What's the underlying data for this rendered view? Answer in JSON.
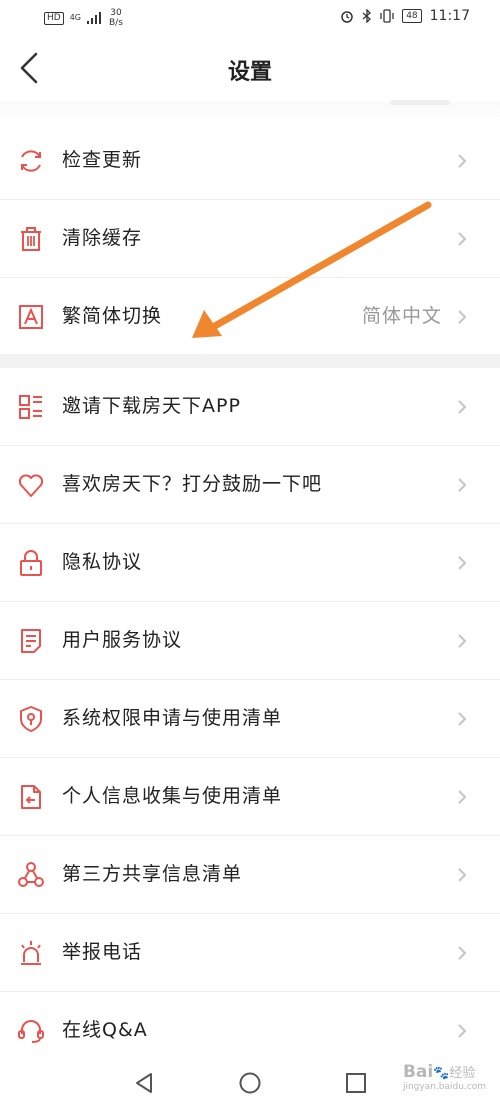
{
  "status_bar": {
    "hd": "HD",
    "network": "4G",
    "speed_value": "30",
    "speed_unit": "B/s",
    "battery": "48",
    "time": "11:17"
  },
  "header": {
    "title": "设置"
  },
  "group1": [
    {
      "label": "检查更新",
      "value": "",
      "icon": "refresh-icon"
    },
    {
      "label": "清除缓存",
      "value": "",
      "icon": "trash-icon"
    },
    {
      "label": "繁简体切换",
      "value": "简体中文",
      "icon": "letter-a-icon"
    }
  ],
  "group2": [
    {
      "label": "邀请下载房天下APP",
      "icon": "qr-code-icon"
    },
    {
      "label": "喜欢房天下？打分鼓励一下吧",
      "icon": "heart-icon"
    },
    {
      "label": "隐私协议",
      "icon": "lock-icon"
    },
    {
      "label": "用户服务协议",
      "icon": "document-icon"
    },
    {
      "label": "系统权限申请与使用清单",
      "icon": "shield-icon"
    },
    {
      "label": "个人信息收集与使用清单",
      "icon": "file-export-icon"
    },
    {
      "label": "第三方共享信息清单",
      "icon": "share-network-icon"
    },
    {
      "label": "举报电话",
      "icon": "alarm-light-icon"
    },
    {
      "label": "在线Q&A",
      "icon": "headset-icon"
    }
  ],
  "colors": {
    "accent": "#e8534f",
    "annotation_arrow": "#f0862e"
  },
  "watermark": {
    "brand": "Bai",
    "text": "经验",
    "url": "jingyan.baidu.com"
  }
}
